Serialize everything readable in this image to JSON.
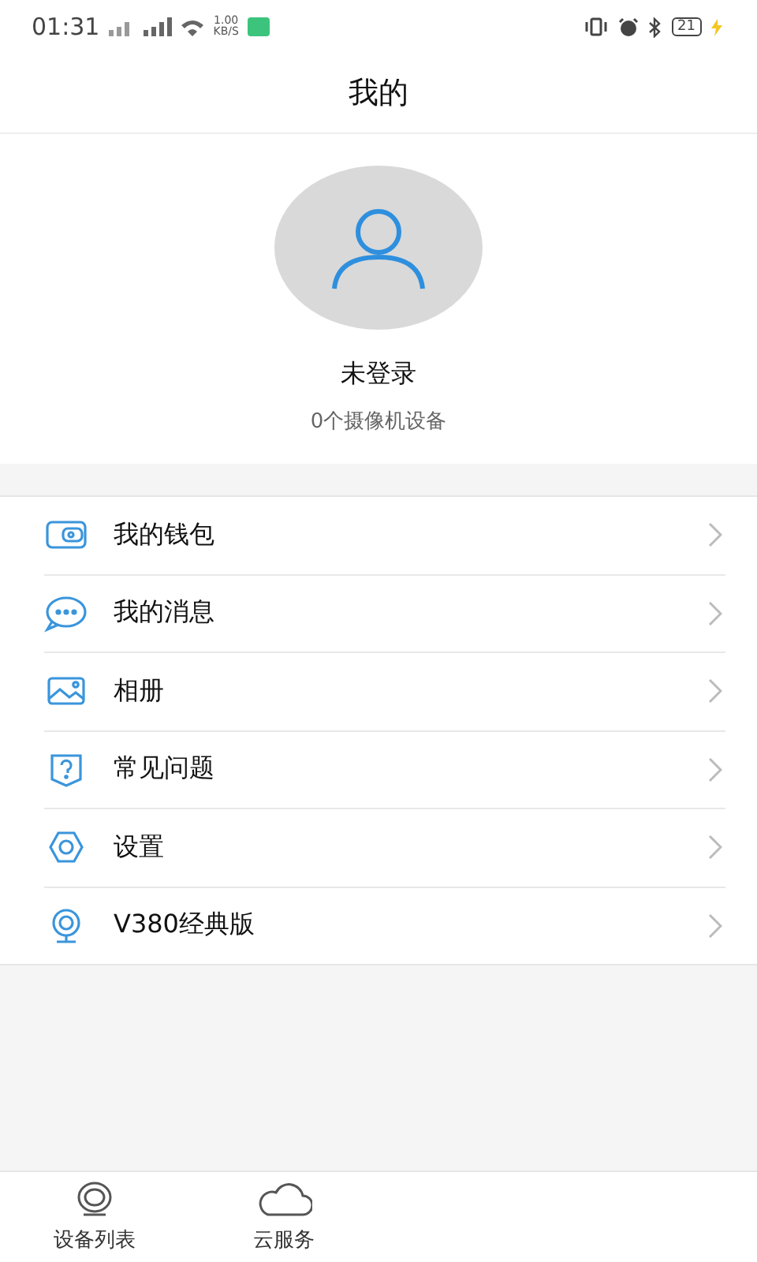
{
  "status_bar": {
    "time": "01:31",
    "speed": "1.00\nKB/S",
    "battery": "21"
  },
  "header": {
    "title": "我的"
  },
  "profile": {
    "name": "未登录",
    "devices": "0个摄像机设备"
  },
  "menu": [
    {
      "label": "我的钱包"
    },
    {
      "label": "我的消息"
    },
    {
      "label": "相册"
    },
    {
      "label": "常见问题"
    },
    {
      "label": "设置"
    },
    {
      "label": "V380经典版"
    }
  ],
  "tab_bar": [
    {
      "label": "设备列表"
    },
    {
      "label": "云服务"
    }
  ]
}
